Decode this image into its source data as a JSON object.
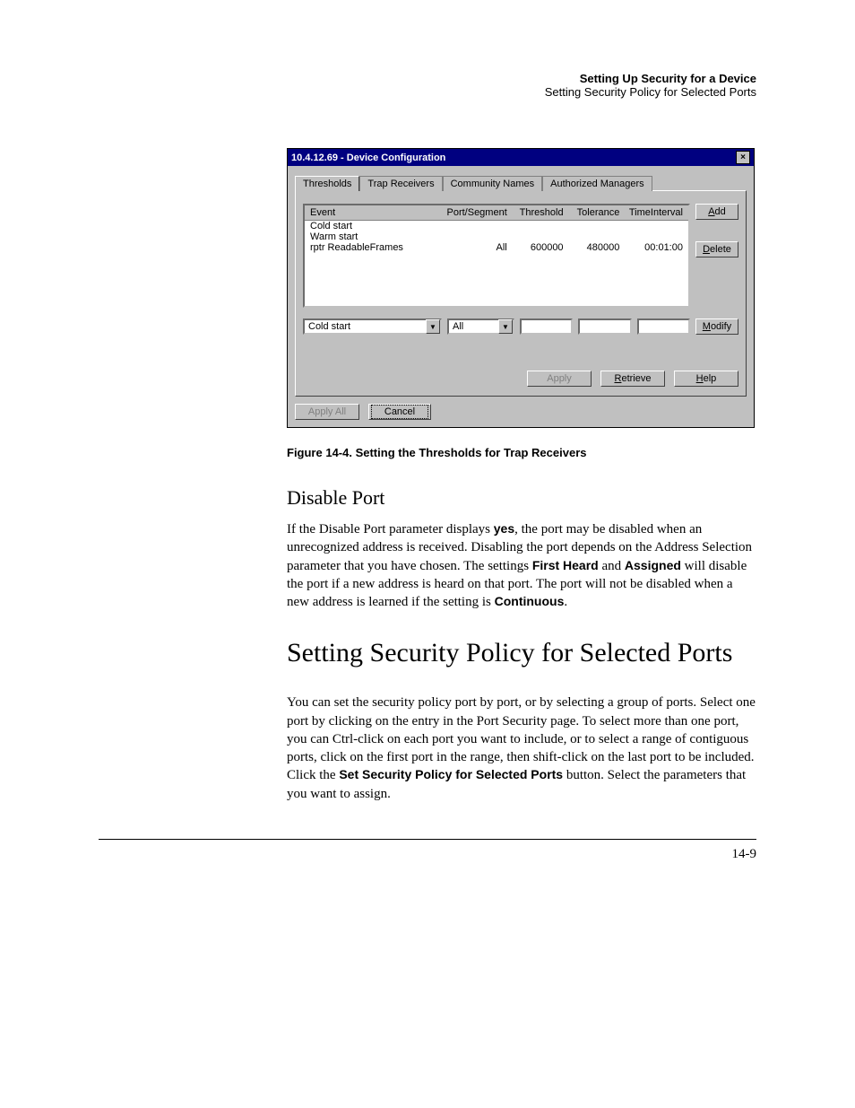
{
  "header": {
    "chapter_title": "Setting Up Security for a Device",
    "section_title": "Setting Security Policy for Selected Ports"
  },
  "dialog": {
    "title": "10.4.12.69 - Device Configuration",
    "close_glyph": "×",
    "tabs": {
      "thresholds": "Thresholds",
      "trap_receivers": "Trap Receivers",
      "community_names": "Community Names",
      "authorized_managers": "Authorized Managers"
    },
    "columns": {
      "event": "Event",
      "port_segment": "Port/Segment",
      "threshold": "Threshold",
      "tolerance": "Tolerance",
      "time_interval": "TimeInterval"
    },
    "rows": [
      {
        "event": "Cold start",
        "port": "",
        "threshold": "",
        "tolerance": "",
        "time": ""
      },
      {
        "event": "Warm start",
        "port": "",
        "threshold": "",
        "tolerance": "",
        "time": ""
      },
      {
        "event": "rptr ReadableFrames",
        "port": "All",
        "threshold": "600000",
        "tolerance": "480000",
        "time": "00:01:00"
      }
    ],
    "buttons": {
      "add": "Add",
      "delete": "Delete",
      "modify": "Modify",
      "apply": "Apply",
      "retrieve": "Retrieve",
      "help": "Help",
      "apply_all": "Apply All",
      "cancel": "Cancel"
    },
    "edit": {
      "event_value": "Cold start",
      "port_value": "All",
      "dropdown_glyph": "▼"
    }
  },
  "figure_caption": "Figure 14-4.  Setting the Thresholds for Trap Receivers",
  "disable_port": {
    "heading": "Disable Port",
    "p_a": "If the Disable Port parameter displays ",
    "p_yes": "yes",
    "p_b": ", the port may be disabled when an unrecognized address is received. Disabling the port depends on the Address Selection parameter that you have chosen. The settings ",
    "p_first_heard": "First Heard",
    "p_c": " and ",
    "p_assigned": "Assigned",
    "p_d": " will disable the port if a new address is heard on that port. The port will not be disabled when a new address is learned if the setting is ",
    "p_continuous": "Continuous",
    "p_e": "."
  },
  "selected_ports": {
    "heading": "Setting Security Policy for Selected Ports",
    "p_a": "You can set the security policy port by port, or by selecting a group of ports. Select one port by clicking on the entry in the Port Security page. To select more than one port, you can Ctrl-click on each port you want to include, or to select a range of contiguous ports, click on the first port in the range, then shift-click on the last port to be included. Click the ",
    "p_btn": "Set Security Policy for Selected Ports",
    "p_b": " button. Select the parameters that you want to assign."
  },
  "page_number": "14-9"
}
